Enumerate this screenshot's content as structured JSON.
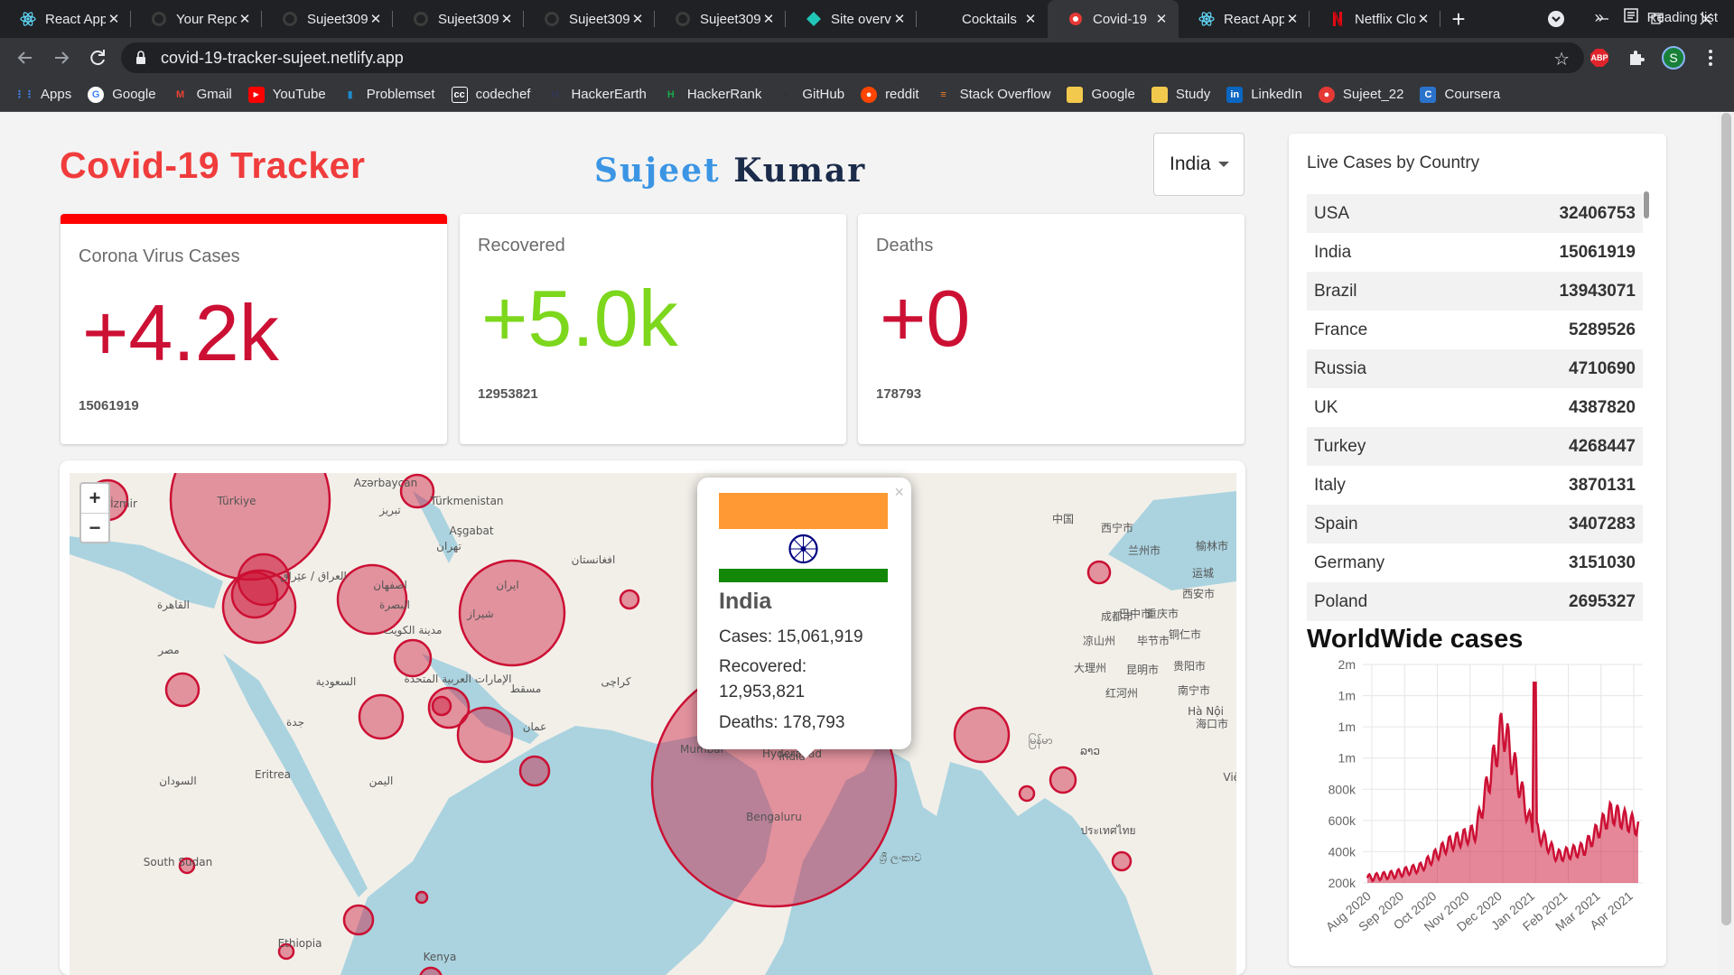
{
  "browser": {
    "tabs": [
      {
        "title": "React App",
        "icon": "react-icon"
      },
      {
        "title": "Your Repositories",
        "icon": "github-icon"
      },
      {
        "title": "Sujeet309",
        "icon": "github-icon"
      },
      {
        "title": "Sujeet309",
        "icon": "github-icon"
      },
      {
        "title": "Sujeet309",
        "icon": "github-icon"
      },
      {
        "title": "Sujeet309",
        "icon": "github-icon"
      },
      {
        "title": "Site overview",
        "icon": "netlify-icon"
      },
      {
        "title": "Cocktails",
        "icon": "blank-icon"
      },
      {
        "title": "Covid-19",
        "icon": "covid-icon",
        "active": true
      },
      {
        "title": "React App",
        "icon": "react-icon"
      },
      {
        "title": "Netflix Clone",
        "icon": "netflix-icon"
      }
    ],
    "url": "covid-19-tracker-sujeet.netlify.app",
    "profile_initial": "S",
    "abp_label": "ABP",
    "bookmarks": [
      {
        "label": "Apps",
        "icon": "apps-grid-icon",
        "color": "#4285f4"
      },
      {
        "label": "Google",
        "icon": "google-icon",
        "color": "#ffffff"
      },
      {
        "label": "Gmail",
        "icon": "gmail-icon",
        "color": "#ea4335"
      },
      {
        "label": "YouTube",
        "icon": "youtube-icon",
        "color": "#ff0000"
      },
      {
        "label": "Problemset",
        "icon": "codeforces-icon",
        "color": "#1f8acb"
      },
      {
        "label": "codechef",
        "icon": "codechef-icon",
        "color": "#ffffff"
      },
      {
        "label": "HackerEarth",
        "icon": "hackerearth-icon",
        "color": "#323754"
      },
      {
        "label": "HackerRank",
        "icon": "hackerrank-icon",
        "color": "#1ba94c"
      },
      {
        "label": "GitHub",
        "icon": "github-icon",
        "color": "#333333"
      },
      {
        "label": "reddit",
        "icon": "reddit-icon",
        "color": "#ff4500"
      },
      {
        "label": "Stack Overflow",
        "icon": "stackoverflow-icon",
        "color": "#f48024"
      },
      {
        "label": "Google",
        "icon": "folder-icon",
        "color": "#f2c94c"
      },
      {
        "label": "Study",
        "icon": "folder-icon",
        "color": "#f2c94c"
      },
      {
        "label": "LinkedIn",
        "icon": "linkedin-icon",
        "color": "#0a66c2"
      },
      {
        "label": "Sujeet_22",
        "icon": "leetcode-icon",
        "color": "#e53935"
      },
      {
        "label": "Coursera",
        "icon": "coursera-icon",
        "color": "#2a73cc"
      }
    ],
    "more_label": "»",
    "reading_list": "Reading list"
  },
  "page": {
    "title": "Covid-19 Tracker",
    "brand_first": "Sujeet",
    "brand_last": "Kumar",
    "country_select": "India",
    "cards": [
      {
        "label": "Corona Virus Cases",
        "value": "+4.2k",
        "total": "15061919",
        "color": "#cc1034"
      },
      {
        "label": "Recovered",
        "value": "+5.0k",
        "total": "12953821",
        "color": "#7dd71d"
      },
      {
        "label": "Deaths",
        "value": "+0",
        "total": "178793",
        "color": "#cc1034"
      }
    ]
  },
  "map": {
    "zoom_in": "+",
    "zoom_out": "−",
    "popup": {
      "country": "India",
      "cases": "Cases: 15,061,919",
      "recovered_label": "Recovered:",
      "recovered_value": "12,953,821",
      "deaths": "Deaths: 178,793",
      "close": "×"
    },
    "labels": [
      "Türkiye",
      "İzmir",
      "Türkmenistan",
      "Aşgabat",
      "Azərbaycan",
      "تبریز",
      "تهران",
      "ایران",
      "اصفهان",
      "شیراز",
      "العراق / عێراق",
      "البصرة",
      "مدينة الكويت",
      "القاهرة",
      "مصر",
      "السعودية",
      "جدة",
      "الإمارات العربية المتحدة",
      "مسقط",
      "عمان",
      "افغانستان",
      "کراچی",
      "India",
      "Mumbai",
      "Hyderabad",
      "Bengaluru",
      "中国",
      "西宁市",
      "兰州市",
      "榆林市",
      "运城",
      "西安市",
      "巴中市",
      "成都市",
      "重庆市",
      "凉山州",
      "毕节市",
      "铜仁市",
      "大理州",
      "昆明市",
      "贵阳市",
      "红河州",
      "南宁市",
      "Hà Nội",
      "海口市",
      "Việt Nam",
      "ประเทศไทย",
      "မြန်မာ",
      "ລາວ",
      "ශ්‍රී ලංකාව",
      "Eritrea",
      "اليمن",
      "السودان",
      "South Sudan",
      "Ethiopia",
      "Kenya"
    ]
  },
  "sidebar": {
    "title": "Live Cases by Country",
    "countries": [
      {
        "name": "USA",
        "cases": "32406753"
      },
      {
        "name": "India",
        "cases": "15061919"
      },
      {
        "name": "Brazil",
        "cases": "13943071"
      },
      {
        "name": "France",
        "cases": "5289526"
      },
      {
        "name": "Russia",
        "cases": "4710690"
      },
      {
        "name": "UK",
        "cases": "4387820"
      },
      {
        "name": "Turkey",
        "cases": "4268447"
      },
      {
        "name": "Italy",
        "cases": "3870131"
      },
      {
        "name": "Spain",
        "cases": "3407283"
      },
      {
        "name": "Germany",
        "cases": "3151030"
      },
      {
        "name": "Poland",
        "cases": "2695327"
      }
    ],
    "chart_title": "WorldWide cases"
  },
  "chart_data": {
    "type": "area",
    "title": "WorldWide cases",
    "ylim": [
      200000,
      2000000
    ],
    "ytick_labels": [
      "2m",
      "1m",
      "1m",
      "1m",
      "800k",
      "600k",
      "400k",
      "200k"
    ],
    "xtick_labels": [
      "Aug 2020",
      "Sep 2020",
      "Oct 2020",
      "Nov 2020",
      "Dec 2020",
      "Jan 2021",
      "Feb 2021",
      "Mar 2021",
      "Apr 2021"
    ],
    "x": [
      "Aug 2020",
      "Sep 2020",
      "Oct 2020",
      "Nov 2020",
      "Dec 2020",
      "Dec 2020",
      "Jan 2021",
      "Feb 2021",
      "Mar 2021",
      "Apr 2021",
      "Apr 2021"
    ],
    "series": [
      {
        "values": [
          240000,
          270000,
          330000,
          520000,
          620000,
          1500000,
          700000,
          420000,
          480000,
          780000,
          660000
        ]
      }
    ],
    "colors": {
      "line": "#cc1034",
      "fill": "#cc1034"
    }
  }
}
